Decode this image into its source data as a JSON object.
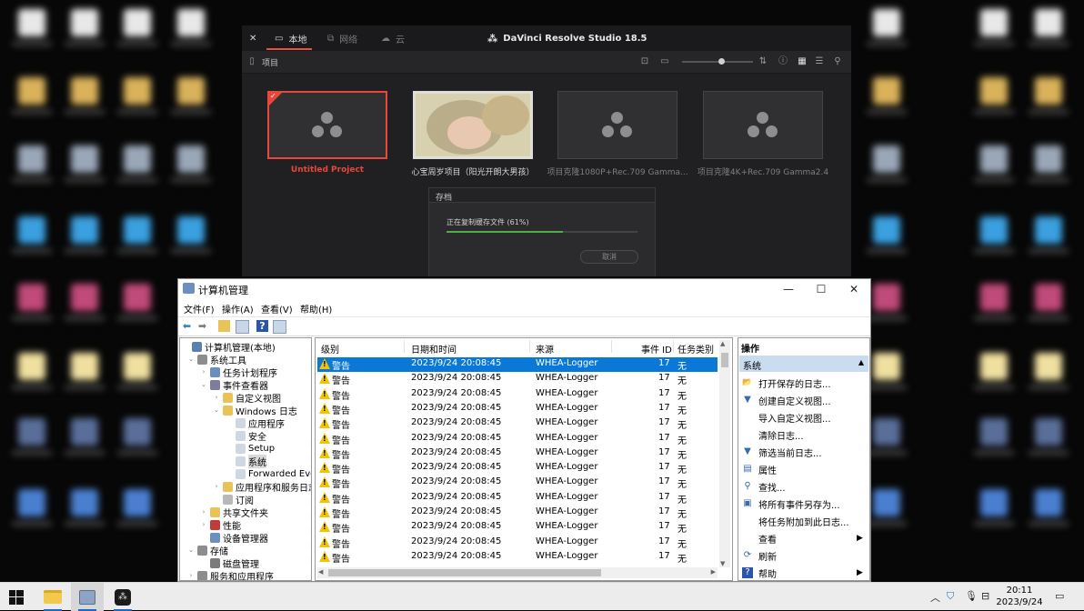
{
  "davinci": {
    "app_title": "DaVinci Resolve Studio 18.5",
    "tabs": [
      {
        "label": "本地"
      },
      {
        "label": "网络"
      },
      {
        "label": "云"
      }
    ],
    "breadcrumb": "项目",
    "zoom_fraction": 0.55,
    "projects": [
      {
        "name": "Untitled Project",
        "state": "active"
      },
      {
        "name": "心宝周岁项目（阳光开朗大男孩）",
        "state": "thumbnail"
      },
      {
        "name": "项目克隆1080P+Rec.709 Gamma...",
        "state": "normal"
      },
      {
        "name": "项目克隆4K+Rec.709 Gamma2.4",
        "state": "normal"
      }
    ],
    "save_dialog": {
      "title": "存档",
      "message": "正在复制缓存文件 (61%)",
      "progress": 0.61,
      "cancel_label": "取消"
    }
  },
  "cm": {
    "title": "计算机管理",
    "menu": [
      "文件(F)",
      "操作(A)",
      "查看(V)",
      "帮助(H)"
    ],
    "tree": [
      {
        "label": "计算机管理(本地)",
        "icon": "computer-icon",
        "color": "#5a7fb0"
      },
      {
        "label": "系统工具",
        "icon": "tools-icon",
        "color": "#8d8d8d"
      },
      {
        "label": "任务计划程序",
        "icon": "clock-icon",
        "color": "#6b8fbf"
      },
      {
        "label": "事件查看器",
        "icon": "event-viewer-icon",
        "color": "#7d7d9c"
      },
      {
        "label": "自定义视图",
        "icon": "folder-icon",
        "color": "#e8c35a"
      },
      {
        "label": "Windows 日志",
        "icon": "folder-icon",
        "color": "#e8c35a"
      },
      {
        "label": "应用程序",
        "icon": "log-icon",
        "color": "#cfd7e3"
      },
      {
        "label": "安全",
        "icon": "log-icon",
        "color": "#cfd7e3"
      },
      {
        "label": "Setup",
        "icon": "log-icon",
        "color": "#cfd7e3"
      },
      {
        "label": "系统",
        "icon": "log-icon",
        "color": "#cfd7e3"
      },
      {
        "label": "Forwarded Even",
        "icon": "log-icon",
        "color": "#cfd7e3"
      },
      {
        "label": "应用程序和服务日志",
        "icon": "folder-icon",
        "color": "#e8c35a"
      },
      {
        "label": "订阅",
        "icon": "subscription-icon",
        "color": "#b8b8b8"
      },
      {
        "label": "共享文件夹",
        "icon": "shared-folder-icon",
        "color": "#e8c35a"
      },
      {
        "label": "性能",
        "icon": "performance-icon",
        "color": "#c33a3a"
      },
      {
        "label": "设备管理器",
        "icon": "device-manager-icon",
        "color": "#6b8fbf"
      },
      {
        "label": "存储",
        "icon": "storage-icon",
        "color": "#8d8d8d"
      },
      {
        "label": "磁盘管理",
        "icon": "disk-icon",
        "color": "#7b7b7b"
      },
      {
        "label": "服务和应用程序",
        "icon": "services-icon",
        "color": "#8d8d8d"
      }
    ],
    "columns": [
      "级别",
      "日期和时间",
      "来源",
      "事件 ID",
      "任务类别"
    ],
    "events": [
      {
        "level": "警告",
        "datetime": "2023/9/24 20:08:45",
        "source": "WHEA-Logger",
        "id": "17",
        "task": "无"
      },
      {
        "level": "警告",
        "datetime": "2023/9/24 20:08:45",
        "source": "WHEA-Logger",
        "id": "17",
        "task": "无"
      },
      {
        "level": "警告",
        "datetime": "2023/9/24 20:08:45",
        "source": "WHEA-Logger",
        "id": "17",
        "task": "无"
      },
      {
        "level": "警告",
        "datetime": "2023/9/24 20:08:45",
        "source": "WHEA-Logger",
        "id": "17",
        "task": "无"
      },
      {
        "level": "警告",
        "datetime": "2023/9/24 20:08:45",
        "source": "WHEA-Logger",
        "id": "17",
        "task": "无"
      },
      {
        "level": "警告",
        "datetime": "2023/9/24 20:08:45",
        "source": "WHEA-Logger",
        "id": "17",
        "task": "无"
      },
      {
        "level": "警告",
        "datetime": "2023/9/24 20:08:45",
        "source": "WHEA-Logger",
        "id": "17",
        "task": "无"
      },
      {
        "level": "警告",
        "datetime": "2023/9/24 20:08:45",
        "source": "WHEA-Logger",
        "id": "17",
        "task": "无"
      },
      {
        "level": "警告",
        "datetime": "2023/9/24 20:08:45",
        "source": "WHEA-Logger",
        "id": "17",
        "task": "无"
      },
      {
        "level": "警告",
        "datetime": "2023/9/24 20:08:45",
        "source": "WHEA-Logger",
        "id": "17",
        "task": "无"
      },
      {
        "level": "警告",
        "datetime": "2023/9/24 20:08:45",
        "source": "WHEA-Logger",
        "id": "17",
        "task": "无"
      },
      {
        "level": "警告",
        "datetime": "2023/9/24 20:08:45",
        "source": "WHEA-Logger",
        "id": "17",
        "task": "无"
      },
      {
        "level": "警告",
        "datetime": "2023/9/24 20:08:45",
        "source": "WHEA-Logger",
        "id": "17",
        "task": "无"
      },
      {
        "level": "警告",
        "datetime": "2023/9/24 20:08:45",
        "source": "WHEA-Logger",
        "id": "17",
        "task": "无"
      }
    ],
    "actions": {
      "heading": "操作",
      "section": "系统",
      "items": [
        {
          "label": "打开保存的日志...",
          "icon": "open-folder-icon",
          "glyph": "📂"
        },
        {
          "label": "创建自定义视图...",
          "icon": "filter-icon",
          "glyph": "▼"
        },
        {
          "label": "导入自定义视图...",
          "icon": "import-icon",
          "glyph": ""
        },
        {
          "label": "清除日志...",
          "icon": "",
          "glyph": ""
        },
        {
          "label": "筛选当前日志...",
          "icon": "filter-icon",
          "glyph": "▼"
        },
        {
          "label": "属性",
          "icon": "properties-icon",
          "glyph": "▤"
        },
        {
          "label": "查找...",
          "icon": "find-icon",
          "glyph": "⚲"
        },
        {
          "label": "将所有事件另存为...",
          "icon": "save-icon",
          "glyph": "▣"
        },
        {
          "label": "将任务附加到此日志...",
          "icon": "",
          "glyph": ""
        },
        {
          "label": "查看",
          "icon": "",
          "glyph": ""
        },
        {
          "label": "刷新",
          "icon": "refresh-icon",
          "glyph": "⟳"
        },
        {
          "label": "帮助",
          "icon": "help-icon",
          "glyph": "?"
        }
      ]
    }
  },
  "taskbar": {
    "time": "20:11",
    "date": "2023/9/24"
  }
}
